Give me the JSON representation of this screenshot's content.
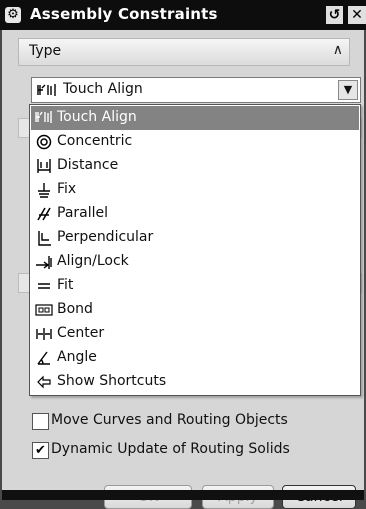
{
  "window": {
    "title": "Assembly Constraints"
  },
  "type_section": {
    "label": "Type"
  },
  "type_select": {
    "value": "Touch Align"
  },
  "dropdown": {
    "items": [
      {
        "label": "Touch Align",
        "icon": "touch-align-icon",
        "selected": true
      },
      {
        "label": "Concentric",
        "icon": "concentric-icon"
      },
      {
        "label": "Distance",
        "icon": "distance-icon"
      },
      {
        "label": "Fix",
        "icon": "fix-icon"
      },
      {
        "label": "Parallel",
        "icon": "parallel-icon"
      },
      {
        "label": "Perpendicular",
        "icon": "perpendicular-icon"
      },
      {
        "label": "Align/Lock",
        "icon": "align-lock-icon"
      },
      {
        "label": "Fit",
        "icon": "fit-icon"
      },
      {
        "label": "Bond",
        "icon": "bond-icon"
      },
      {
        "label": "Center",
        "icon": "center-icon"
      },
      {
        "label": "Angle",
        "icon": "angle-icon"
      },
      {
        "label": "Show Shortcuts",
        "icon": "show-shortcuts-icon"
      }
    ]
  },
  "options": {
    "move_curves_label": "Move Curves and Routing Objects",
    "dynamic_update_label": "Dynamic Update of Routing Solids",
    "dynamic_update_checked": true
  },
  "buttons": {
    "ok": "OK",
    "apply": "Apply",
    "cancel": "Cancel"
  },
  "colors": {
    "selection": "#838383",
    "titlebar": "#0d0d0d"
  }
}
